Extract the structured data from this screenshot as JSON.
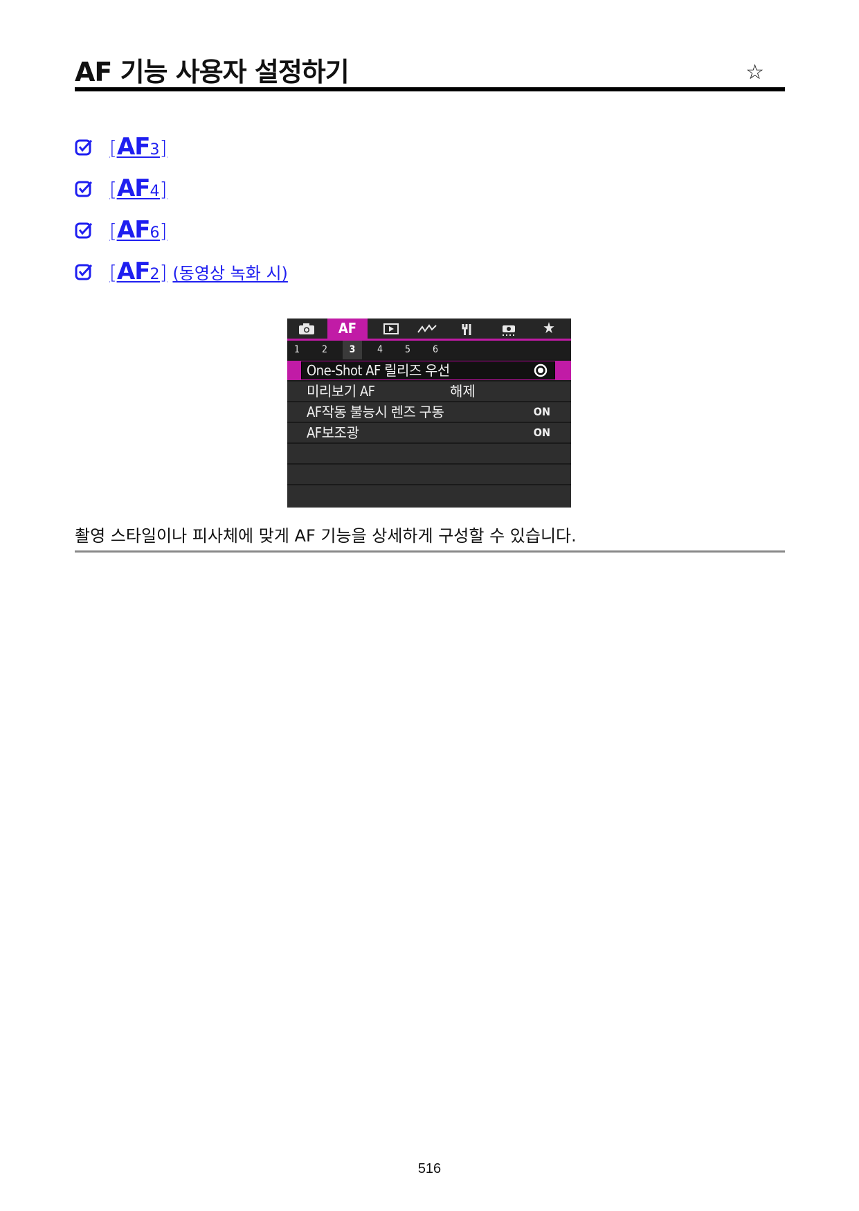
{
  "header": {
    "title": "AF 기능 사용자 설정하기",
    "star_icon": "star-outline-icon"
  },
  "links": [
    {
      "bracket_open": "[",
      "af": "AF",
      "num": "3",
      "bracket_close": "]",
      "suffix": ""
    },
    {
      "bracket_open": "[",
      "af": "AF",
      "num": "4",
      "bracket_close": "]",
      "suffix": ""
    },
    {
      "bracket_open": "[",
      "af": "AF",
      "num": "6",
      "bracket_close": "]",
      "suffix": ""
    },
    {
      "bracket_open": "[",
      "af": "AF",
      "num": "2",
      "bracket_close": "]",
      "suffix": "(동영상 녹화 시)"
    }
  ],
  "link_color": "#1f1ff0",
  "screen": {
    "accent": "#c11ba6",
    "tabs": [
      "camera-icon",
      "AF",
      "playback-icon",
      "wireless-icon",
      "wrench-icon",
      "custom-icon",
      "star-icon"
    ],
    "active_tab_label": "AF",
    "subtabs": [
      "1",
      "2",
      "3",
      "4",
      "5",
      "6"
    ],
    "active_subtab": "3",
    "menu": [
      {
        "label": "One-Shot AF 릴리즈 우선",
        "value": "",
        "icon": "priority-release-icon"
      },
      {
        "label": "미리보기 AF",
        "value": "해제"
      },
      {
        "label": "AF작동 불능시 렌즈 구동",
        "value": "ON"
      },
      {
        "label": "AF보조광",
        "value": "ON"
      }
    ]
  },
  "description": "촬영 스타일이나 피사체에 맞게 AF 기능을 상세하게 구성할 수 있습니다.",
  "page_number": "516"
}
